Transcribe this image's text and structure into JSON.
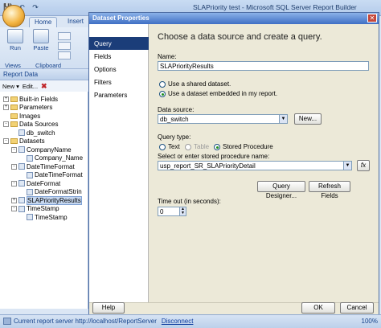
{
  "app": {
    "title": "SLAPriority test - Microsoft SQL Server Report Builder"
  },
  "ribbon": {
    "tabs": [
      "Home",
      "Insert"
    ],
    "buttons": {
      "run": "Run",
      "paste": "Paste"
    },
    "groups": {
      "views": "Views",
      "clipboard": "Clipboard"
    }
  },
  "report_data": {
    "title": "Report Data",
    "toolbar": {
      "new": "New ▾",
      "edit": "Edit...",
      "delete": "✖"
    },
    "tree": [
      {
        "label": "Built-in Fields",
        "level": 0,
        "exp": "+",
        "icon": "folder"
      },
      {
        "label": "Parameters",
        "level": 0,
        "exp": "+",
        "icon": "folder"
      },
      {
        "label": "Images",
        "level": 0,
        "exp": "",
        "icon": "folder"
      },
      {
        "label": "Data Sources",
        "level": 0,
        "exp": "-",
        "icon": "folder"
      },
      {
        "label": "db_switch",
        "level": 1,
        "exp": "",
        "icon": "field"
      },
      {
        "label": "Datasets",
        "level": 0,
        "exp": "-",
        "icon": "folder"
      },
      {
        "label": "CompanyName",
        "level": 1,
        "exp": "-",
        "icon": "field"
      },
      {
        "label": "Company_Name",
        "level": 2,
        "exp": "",
        "icon": "field"
      },
      {
        "label": "DateTimeFormat",
        "level": 1,
        "exp": "-",
        "icon": "field"
      },
      {
        "label": "DateTimeFormat",
        "level": 2,
        "exp": "",
        "icon": "field"
      },
      {
        "label": "DateFormat",
        "level": 1,
        "exp": "-",
        "icon": "field"
      },
      {
        "label": "DateFormatStrin",
        "level": 2,
        "exp": "",
        "icon": "field"
      },
      {
        "label": "SLAPriorityResults",
        "level": 1,
        "exp": "+",
        "icon": "field",
        "selected": true
      },
      {
        "label": "TimeStamp",
        "level": 1,
        "exp": "-",
        "icon": "field"
      },
      {
        "label": "TimeStamp",
        "level": 2,
        "exp": "",
        "icon": "field"
      }
    ]
  },
  "dialog": {
    "title": "Dataset Properties",
    "nav": [
      "Query",
      "Fields",
      "Options",
      "Filters",
      "Parameters"
    ],
    "heading": "Choose a data source and create a query.",
    "name_label": "Name:",
    "name_value": "SLAPriorityResults",
    "shared_radio": "Use a shared dataset.",
    "embedded_radio": "Use a dataset embedded in my report.",
    "source_label": "Data source:",
    "source_value": "db_switch",
    "new_button": "New...",
    "query_type_label": "Query type:",
    "qt_text": "Text",
    "qt_table": "Table",
    "qt_sp": "Stored Procedure",
    "sp_label": "Select or enter stored procedure name:",
    "sp_value": "usp_report_SR_SLAPriorityDetail",
    "fx_button": "fx",
    "query_designer": "Query Designer...",
    "refresh_fields": "Refresh Fields",
    "timeout_label": "Time out (in seconds):",
    "timeout_value": "0",
    "help": "Help",
    "ok": "OK",
    "cancel": "Cancel"
  },
  "status": {
    "text": "Current report server http://localhost/ReportServer",
    "disconnect": "Disconnect",
    "zoom": "100%"
  }
}
